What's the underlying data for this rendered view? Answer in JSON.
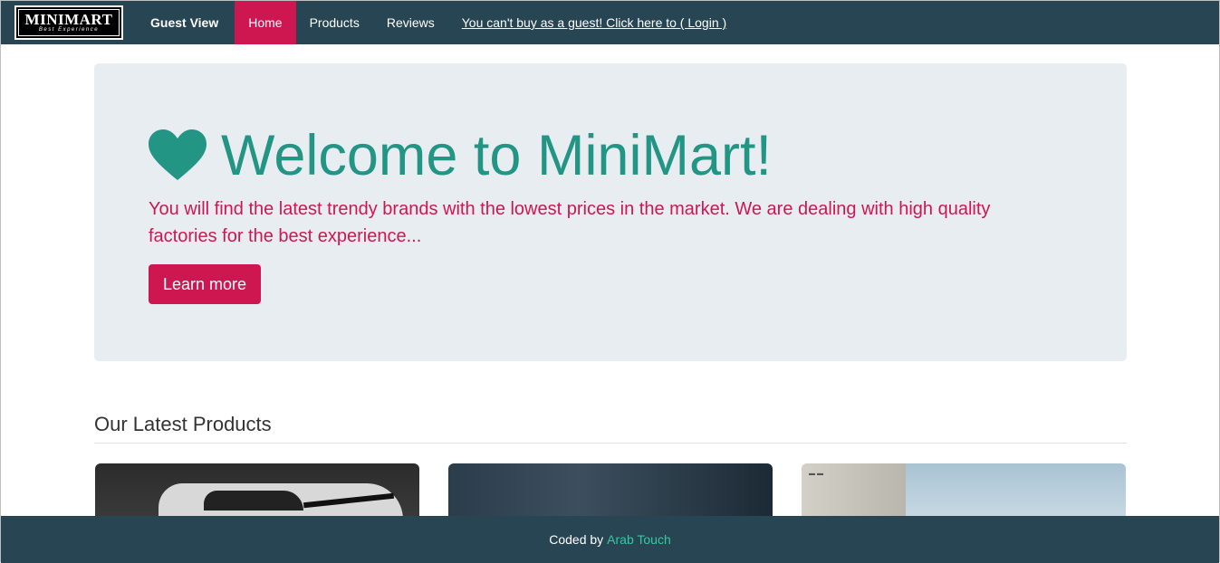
{
  "brand": {
    "name": "MINIMART",
    "tagline": "Best Experience"
  },
  "navbar": {
    "guest_label": "Guest View",
    "items": [
      {
        "label": "Home",
        "active": true
      },
      {
        "label": "Products",
        "active": false
      },
      {
        "label": "Reviews",
        "active": false
      }
    ],
    "login_prompt": "You can't buy as a guest! Click here to ( Login )"
  },
  "jumbotron": {
    "icon": "heart-icon",
    "title": "Welcome to MiniMart!",
    "text": "You will find the latest trendy brands with the lowest prices in the market. We are dealing with high quality factories for the best experience...",
    "button_label": "Learn more"
  },
  "latest": {
    "title": "Our Latest Products"
  },
  "footer": {
    "prefix": "Coded by",
    "author": "Arab Touch"
  },
  "colors": {
    "navbar_bg": "#274552",
    "accent": "#ce1750",
    "title_teal": "#229585",
    "footer_link": "#36c9a3",
    "jumbotron_bg": "#e8edf1"
  }
}
